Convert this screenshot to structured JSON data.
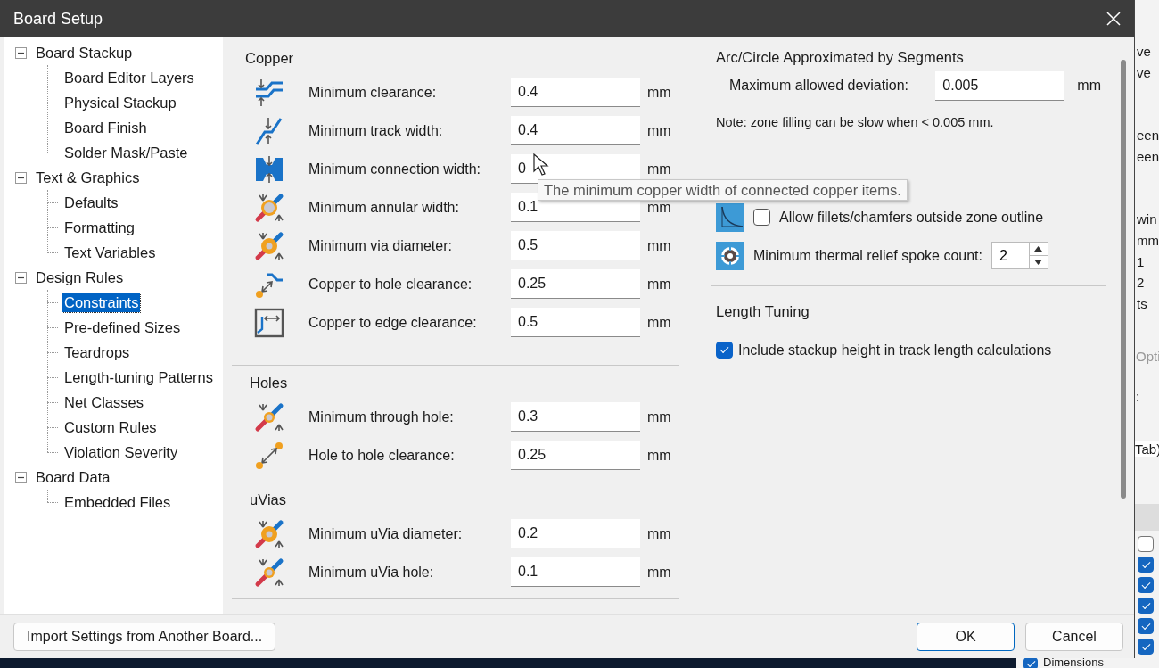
{
  "window": {
    "title": "Board Setup"
  },
  "tree": [
    {
      "label": "Board Stackup",
      "expanded": true,
      "selected": false,
      "children": [
        {
          "label": "Board Editor Layers",
          "selected": false
        },
        {
          "label": "Physical Stackup",
          "selected": false
        },
        {
          "label": "Board Finish",
          "selected": false
        },
        {
          "label": "Solder Mask/Paste",
          "selected": false
        }
      ]
    },
    {
      "label": "Text & Graphics",
      "expanded": true,
      "selected": false,
      "children": [
        {
          "label": "Defaults",
          "selected": false
        },
        {
          "label": "Formatting",
          "selected": false
        },
        {
          "label": "Text Variables",
          "selected": false
        }
      ]
    },
    {
      "label": "Design Rules",
      "expanded": true,
      "selected": false,
      "children": [
        {
          "label": "Constraints",
          "selected": true
        },
        {
          "label": "Pre-defined Sizes",
          "selected": false
        },
        {
          "label": "Teardrops",
          "selected": false
        },
        {
          "label": "Length-tuning Patterns",
          "selected": false
        },
        {
          "label": "Net Classes",
          "selected": false
        },
        {
          "label": "Custom Rules",
          "selected": false
        },
        {
          "label": "Violation Severity",
          "selected": false
        }
      ]
    },
    {
      "label": "Board Data",
      "expanded": true,
      "selected": false,
      "children": [
        {
          "label": "Embedded Files",
          "selected": false
        }
      ]
    }
  ],
  "sections": [
    {
      "title": "Copper",
      "rows": [
        {
          "kind": "clearance",
          "label": "Minimum clearance:",
          "value": "0.4",
          "unit": "mm"
        },
        {
          "kind": "track",
          "label": "Minimum track width:",
          "value": "0.4",
          "unit": "mm"
        },
        {
          "kind": "connection",
          "label": "Minimum connection width:",
          "value": "0",
          "unit": "mm"
        },
        {
          "kind": "annular",
          "label": "Minimum annular width:",
          "value": "0.1",
          "unit": "mm"
        },
        {
          "kind": "via",
          "label": "Minimum via diameter:",
          "value": "0.5",
          "unit": "mm"
        },
        {
          "kind": "holeclearance",
          "label": "Copper to hole clearance:",
          "value": "0.25",
          "unit": "mm"
        },
        {
          "kind": "edge",
          "label": "Copper to edge clearance:",
          "value": "0.5",
          "unit": "mm"
        }
      ]
    },
    {
      "title": "Holes",
      "rows": [
        {
          "kind": "drill",
          "label": "Minimum through hole:",
          "value": "0.3",
          "unit": "mm"
        },
        {
          "kind": "spacing",
          "label": "Hole to hole clearance:",
          "value": "0.25",
          "unit": "mm"
        }
      ]
    },
    {
      "title": "uVias",
      "rows": [
        {
          "kind": "via",
          "label": "Minimum uVia diameter:",
          "value": "0.2",
          "unit": "mm"
        },
        {
          "kind": "drill",
          "label": "Minimum uVia hole:",
          "value": "0.1",
          "unit": "mm"
        }
      ]
    }
  ],
  "tooltip": "The minimum copper width of connected copper items.",
  "arc": {
    "title": "Arc/Circle Approximated by Segments",
    "label": "Maximum allowed deviation:",
    "value": "0.005",
    "unit": "mm",
    "note": "Note: zone filling can be slow when < 0.005 mm."
  },
  "zone_fill": {
    "fillets": {
      "label": "Allow fillets/chamfers outside zone outline",
      "checked": false
    },
    "spokes": {
      "label": "Minimum thermal relief spoke count:",
      "value": "2"
    }
  },
  "length_tuning": {
    "title": "Length Tuning",
    "option": {
      "label": "Include stackup height in track length calculations",
      "checked": true
    }
  },
  "buttons": {
    "import": "Import Settings from Another Board...",
    "ok": "OK",
    "cancel": "Cancel"
  },
  "background_window": {
    "fragment_groups": [
      [
        "ve",
        "ve"
      ],
      [
        "een",
        "een"
      ],
      [
        "win",
        "mm",
        "1",
        "2",
        "ts"
      ]
    ],
    "option_fragment": "Opti",
    "colon_fragment": ":",
    "tab_fragment": "Tab)",
    "checkboxes": [
      {
        "checked": false
      },
      {
        "checked": true
      },
      {
        "checked": true
      },
      {
        "checked": true
      },
      {
        "checked": true
      },
      {
        "checked": true
      }
    ],
    "last_item": {
      "label": "Dimensions",
      "checked": true
    }
  }
}
